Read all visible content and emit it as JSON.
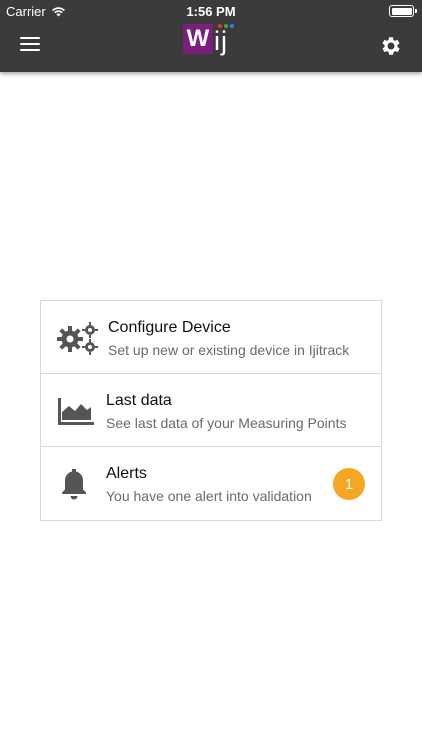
{
  "status_bar": {
    "carrier": "Carrier",
    "time": "1:56 PM",
    "icons": [
      "wifi-icon",
      "battery-icon"
    ]
  },
  "app_bar": {
    "logo_text": "Wiji",
    "logo_w": "W",
    "logo_ij": "ij",
    "menu_icon": "hamburger-menu-icon",
    "settings_icon": "gear-icon",
    "background": "#3b3b3b",
    "logo_color": "#7b1f7e",
    "logo_dot_colors": [
      "#e53935",
      "#43a047",
      "#1e88e5"
    ]
  },
  "menu": {
    "items": [
      {
        "icon": "gears-icon",
        "title": "Configure Device",
        "subtitle": "Set up new or existing device in Ijitrack"
      },
      {
        "icon": "area-chart-icon",
        "title": "Last data",
        "subtitle": "See last data of your Measuring Points"
      },
      {
        "icon": "bell-icon",
        "title": "Alerts",
        "subtitle": "You have one alert into validation",
        "badge": "1",
        "badge_color": "#f6a623"
      }
    ]
  }
}
